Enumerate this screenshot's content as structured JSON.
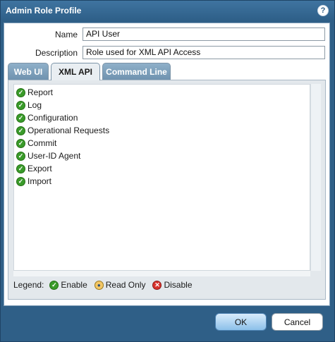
{
  "window": {
    "title": "Admin Role Profile",
    "help_label": "?"
  },
  "form": {
    "name_label": "Name",
    "name_value": "API User",
    "description_label": "Description",
    "description_value": "Role used for XML API Access"
  },
  "tabs": [
    {
      "label": "Web UI",
      "active": false
    },
    {
      "label": "XML API",
      "active": true
    },
    {
      "label": "Command Line",
      "active": false
    }
  ],
  "permissions": [
    {
      "label": "Report",
      "state": "enable"
    },
    {
      "label": "Log",
      "state": "enable"
    },
    {
      "label": "Configuration",
      "state": "enable"
    },
    {
      "label": "Operational Requests",
      "state": "enable"
    },
    {
      "label": "Commit",
      "state": "enable"
    },
    {
      "label": "User-ID Agent",
      "state": "enable"
    },
    {
      "label": "Export",
      "state": "enable"
    },
    {
      "label": "Import",
      "state": "enable"
    }
  ],
  "legend": {
    "title": "Legend:",
    "enable": "Enable",
    "read_only": "Read Only",
    "disable": "Disable"
  },
  "buttons": {
    "ok": "OK",
    "cancel": "Cancel"
  },
  "colors": {
    "titlebar": "#2f5f87",
    "enable": "#3a9b2a",
    "read_only": "#f3c766",
    "disable": "#d8322c"
  }
}
